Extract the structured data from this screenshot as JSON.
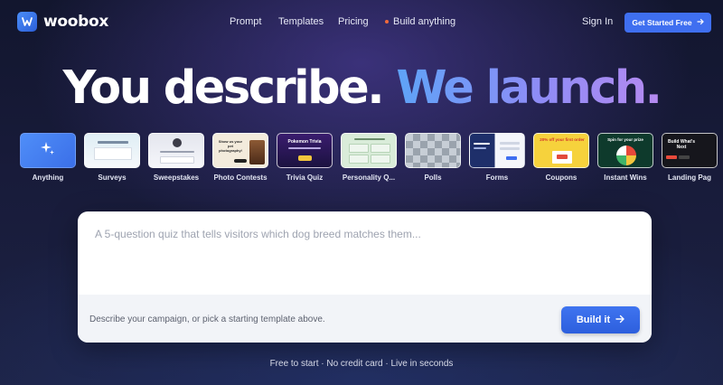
{
  "brand": {
    "name": "woobox"
  },
  "nav": {
    "links": [
      "Prompt",
      "Templates",
      "Pricing",
      "Build anything"
    ],
    "sign_in": "Sign In",
    "cta": "Get Started Free"
  },
  "hero": {
    "part1": "You describe.",
    "part2": "We launch."
  },
  "templates": [
    {
      "label": "Anything",
      "icon": "sparkles-icon"
    },
    {
      "label": "Surveys"
    },
    {
      "label": "Sweepstakes"
    },
    {
      "label": "Photo Contests",
      "thumb_text": "Show us your pet photography!"
    },
    {
      "label": "Trivia Quiz",
      "thumb_text": "Pokemon Trivia"
    },
    {
      "label": "Personality Q..."
    },
    {
      "label": "Polls"
    },
    {
      "label": "Forms"
    },
    {
      "label": "Coupons",
      "thumb_text": "20% off your first order"
    },
    {
      "label": "Instant Wins",
      "thumb_text": "Spin for your prize"
    },
    {
      "label": "Landing Pag",
      "thumb_text": "Build What's Next"
    }
  ],
  "prompt": {
    "placeholder": "A 5-question quiz that tells visitors which dog breed matches them...",
    "hint": "Describe your campaign, or pick a starting template above.",
    "button": "Build it"
  },
  "footer_note": "Free to start · No credit card · Live in seconds",
  "colors": {
    "accent": "#3f6ff0",
    "dot": "#f06a3b",
    "gradient_start": "#5ea3f7",
    "gradient_end": "#b58af0"
  }
}
